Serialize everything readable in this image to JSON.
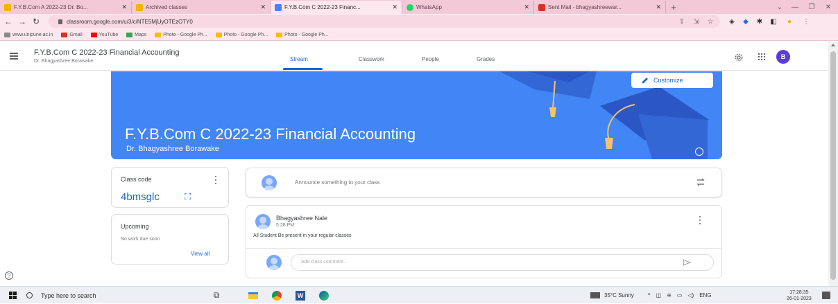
{
  "browser": {
    "tabs": [
      {
        "title": "F.Y.B.Com A 2022-23 Dr. Bo...",
        "favicon_color": "#f4b400",
        "active": false
      },
      {
        "title": "Archived classes",
        "favicon_color": "#f4b400",
        "active": false
      },
      {
        "title": "F.Y.B.Com C 2022-23 Financ...",
        "favicon_color": "#4285f4",
        "active": true
      },
      {
        "title": "WhatsApp",
        "favicon_color": "#25d366",
        "active": false
      },
      {
        "title": "Sent Mail - bhagyashreewar...",
        "favicon_color": "#d93025",
        "active": false
      }
    ],
    "new_tab_label": "+",
    "url": "classroom.google.com/u/3/c/NTE5MjUyOTEzOTY0",
    "bookmarks": [
      {
        "label": "www.unipune.ac.in",
        "color": "#888888"
      },
      {
        "label": "Gmail",
        "color": "#d93025"
      },
      {
        "label": "YouTube",
        "color": "#ff0000"
      },
      {
        "label": "Maps",
        "color": "#34a853"
      },
      {
        "label": "Photo - Google Ph...",
        "color": "#fbbc04"
      },
      {
        "label": "Photo - Google Ph...",
        "color": "#fbbc04"
      },
      {
        "label": "Photo - Google Ph...",
        "color": "#fbbc04"
      }
    ]
  },
  "classroom": {
    "header": {
      "title": "F.Y.B.Com C 2022-23 Financial Accounting",
      "subtitle": "Dr. Bhagyashree Borawake",
      "tabs": [
        "Stream",
        "Classwork",
        "People",
        "Grades"
      ],
      "active_tab": "Stream",
      "avatar_letter": "B",
      "avatar_color": "#5b3fd1"
    },
    "banner": {
      "title": "F.Y.B.Com C 2022-23 Financial Accounting",
      "teacher": "Dr. Bhagyashree Borawake",
      "customize_label": "Customize",
      "color": "#4285f4"
    },
    "class_code": {
      "label": "Class code",
      "value": "4bmsglc"
    },
    "upcoming": {
      "title": "Upcoming",
      "empty_text": "No work due soon",
      "view_all": "View all"
    },
    "announce": {
      "placeholder": "Announce something to your class"
    },
    "post": {
      "author": "Bhagyashree Nale",
      "time": "5:28 PM",
      "text": "All Student Be present in your regular classes",
      "comment_placeholder": "Add class comment..."
    }
  },
  "taskbar": {
    "search_placeholder": "Type here to search",
    "weather": "35°C  Sunny",
    "language": "ENG",
    "time": "17:28:35",
    "date": "26-01-2023"
  }
}
